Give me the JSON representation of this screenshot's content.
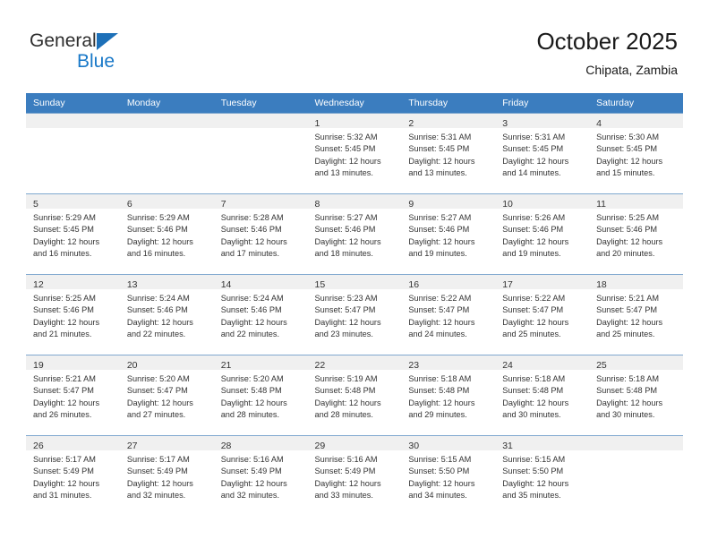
{
  "brand": {
    "name_top": "General",
    "name_bottom": "Blue",
    "accent_color": "#1878c8",
    "triangle_color": "#1d70b8"
  },
  "header": {
    "title": "October 2025",
    "subtitle": "Chipata, Zambia"
  },
  "calendar": {
    "header_background": "#3b7dbf",
    "daynum_band_background": "#f0f0f0",
    "weekdays": [
      "Sunday",
      "Monday",
      "Tuesday",
      "Wednesday",
      "Thursday",
      "Friday",
      "Saturday"
    ],
    "weeks": [
      [
        {
          "day": "",
          "sunrise": "",
          "sunset": "",
          "daylight_line1": "",
          "daylight_line2": ""
        },
        {
          "day": "",
          "sunrise": "",
          "sunset": "",
          "daylight_line1": "",
          "daylight_line2": ""
        },
        {
          "day": "",
          "sunrise": "",
          "sunset": "",
          "daylight_line1": "",
          "daylight_line2": ""
        },
        {
          "day": "1",
          "sunrise": "Sunrise: 5:32 AM",
          "sunset": "Sunset: 5:45 PM",
          "daylight_line1": "Daylight: 12 hours",
          "daylight_line2": "and 13 minutes."
        },
        {
          "day": "2",
          "sunrise": "Sunrise: 5:31 AM",
          "sunset": "Sunset: 5:45 PM",
          "daylight_line1": "Daylight: 12 hours",
          "daylight_line2": "and 13 minutes."
        },
        {
          "day": "3",
          "sunrise": "Sunrise: 5:31 AM",
          "sunset": "Sunset: 5:45 PM",
          "daylight_line1": "Daylight: 12 hours",
          "daylight_line2": "and 14 minutes."
        },
        {
          "day": "4",
          "sunrise": "Sunrise: 5:30 AM",
          "sunset": "Sunset: 5:45 PM",
          "daylight_line1": "Daylight: 12 hours",
          "daylight_line2": "and 15 minutes."
        }
      ],
      [
        {
          "day": "5",
          "sunrise": "Sunrise: 5:29 AM",
          "sunset": "Sunset: 5:45 PM",
          "daylight_line1": "Daylight: 12 hours",
          "daylight_line2": "and 16 minutes."
        },
        {
          "day": "6",
          "sunrise": "Sunrise: 5:29 AM",
          "sunset": "Sunset: 5:46 PM",
          "daylight_line1": "Daylight: 12 hours",
          "daylight_line2": "and 16 minutes."
        },
        {
          "day": "7",
          "sunrise": "Sunrise: 5:28 AM",
          "sunset": "Sunset: 5:46 PM",
          "daylight_line1": "Daylight: 12 hours",
          "daylight_line2": "and 17 minutes."
        },
        {
          "day": "8",
          "sunrise": "Sunrise: 5:27 AM",
          "sunset": "Sunset: 5:46 PM",
          "daylight_line1": "Daylight: 12 hours",
          "daylight_line2": "and 18 minutes."
        },
        {
          "day": "9",
          "sunrise": "Sunrise: 5:27 AM",
          "sunset": "Sunset: 5:46 PM",
          "daylight_line1": "Daylight: 12 hours",
          "daylight_line2": "and 19 minutes."
        },
        {
          "day": "10",
          "sunrise": "Sunrise: 5:26 AM",
          "sunset": "Sunset: 5:46 PM",
          "daylight_line1": "Daylight: 12 hours",
          "daylight_line2": "and 19 minutes."
        },
        {
          "day": "11",
          "sunrise": "Sunrise: 5:25 AM",
          "sunset": "Sunset: 5:46 PM",
          "daylight_line1": "Daylight: 12 hours",
          "daylight_line2": "and 20 minutes."
        }
      ],
      [
        {
          "day": "12",
          "sunrise": "Sunrise: 5:25 AM",
          "sunset": "Sunset: 5:46 PM",
          "daylight_line1": "Daylight: 12 hours",
          "daylight_line2": "and 21 minutes."
        },
        {
          "day": "13",
          "sunrise": "Sunrise: 5:24 AM",
          "sunset": "Sunset: 5:46 PM",
          "daylight_line1": "Daylight: 12 hours",
          "daylight_line2": "and 22 minutes."
        },
        {
          "day": "14",
          "sunrise": "Sunrise: 5:24 AM",
          "sunset": "Sunset: 5:46 PM",
          "daylight_line1": "Daylight: 12 hours",
          "daylight_line2": "and 22 minutes."
        },
        {
          "day": "15",
          "sunrise": "Sunrise: 5:23 AM",
          "sunset": "Sunset: 5:47 PM",
          "daylight_line1": "Daylight: 12 hours",
          "daylight_line2": "and 23 minutes."
        },
        {
          "day": "16",
          "sunrise": "Sunrise: 5:22 AM",
          "sunset": "Sunset: 5:47 PM",
          "daylight_line1": "Daylight: 12 hours",
          "daylight_line2": "and 24 minutes."
        },
        {
          "day": "17",
          "sunrise": "Sunrise: 5:22 AM",
          "sunset": "Sunset: 5:47 PM",
          "daylight_line1": "Daylight: 12 hours",
          "daylight_line2": "and 25 minutes."
        },
        {
          "day": "18",
          "sunrise": "Sunrise: 5:21 AM",
          "sunset": "Sunset: 5:47 PM",
          "daylight_line1": "Daylight: 12 hours",
          "daylight_line2": "and 25 minutes."
        }
      ],
      [
        {
          "day": "19",
          "sunrise": "Sunrise: 5:21 AM",
          "sunset": "Sunset: 5:47 PM",
          "daylight_line1": "Daylight: 12 hours",
          "daylight_line2": "and 26 minutes."
        },
        {
          "day": "20",
          "sunrise": "Sunrise: 5:20 AM",
          "sunset": "Sunset: 5:47 PM",
          "daylight_line1": "Daylight: 12 hours",
          "daylight_line2": "and 27 minutes."
        },
        {
          "day": "21",
          "sunrise": "Sunrise: 5:20 AM",
          "sunset": "Sunset: 5:48 PM",
          "daylight_line1": "Daylight: 12 hours",
          "daylight_line2": "and 28 minutes."
        },
        {
          "day": "22",
          "sunrise": "Sunrise: 5:19 AM",
          "sunset": "Sunset: 5:48 PM",
          "daylight_line1": "Daylight: 12 hours",
          "daylight_line2": "and 28 minutes."
        },
        {
          "day": "23",
          "sunrise": "Sunrise: 5:18 AM",
          "sunset": "Sunset: 5:48 PM",
          "daylight_line1": "Daylight: 12 hours",
          "daylight_line2": "and 29 minutes."
        },
        {
          "day": "24",
          "sunrise": "Sunrise: 5:18 AM",
          "sunset": "Sunset: 5:48 PM",
          "daylight_line1": "Daylight: 12 hours",
          "daylight_line2": "and 30 minutes."
        },
        {
          "day": "25",
          "sunrise": "Sunrise: 5:18 AM",
          "sunset": "Sunset: 5:48 PM",
          "daylight_line1": "Daylight: 12 hours",
          "daylight_line2": "and 30 minutes."
        }
      ],
      [
        {
          "day": "26",
          "sunrise": "Sunrise: 5:17 AM",
          "sunset": "Sunset: 5:49 PM",
          "daylight_line1": "Daylight: 12 hours",
          "daylight_line2": "and 31 minutes."
        },
        {
          "day": "27",
          "sunrise": "Sunrise: 5:17 AM",
          "sunset": "Sunset: 5:49 PM",
          "daylight_line1": "Daylight: 12 hours",
          "daylight_line2": "and 32 minutes."
        },
        {
          "day": "28",
          "sunrise": "Sunrise: 5:16 AM",
          "sunset": "Sunset: 5:49 PM",
          "daylight_line1": "Daylight: 12 hours",
          "daylight_line2": "and 32 minutes."
        },
        {
          "day": "29",
          "sunrise": "Sunrise: 5:16 AM",
          "sunset": "Sunset: 5:49 PM",
          "daylight_line1": "Daylight: 12 hours",
          "daylight_line2": "and 33 minutes."
        },
        {
          "day": "30",
          "sunrise": "Sunrise: 5:15 AM",
          "sunset": "Sunset: 5:50 PM",
          "daylight_line1": "Daylight: 12 hours",
          "daylight_line2": "and 34 minutes."
        },
        {
          "day": "31",
          "sunrise": "Sunrise: 5:15 AM",
          "sunset": "Sunset: 5:50 PM",
          "daylight_line1": "Daylight: 12 hours",
          "daylight_line2": "and 35 minutes."
        },
        {
          "day": "",
          "sunrise": "",
          "sunset": "",
          "daylight_line1": "",
          "daylight_line2": ""
        }
      ]
    ]
  }
}
